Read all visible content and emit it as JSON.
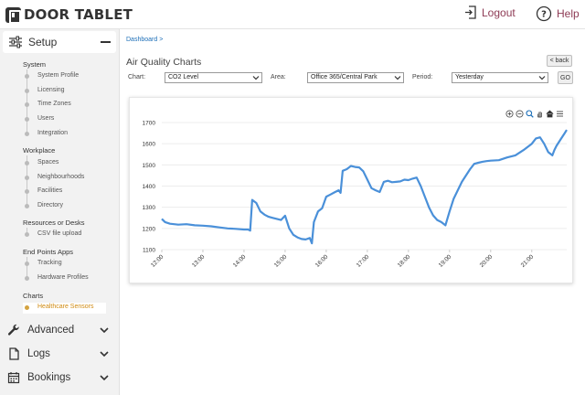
{
  "app": {
    "logo_text": "DOOR TABLET"
  },
  "header": {
    "logout_label": "Logout",
    "help_label": "Help"
  },
  "sidebar": {
    "setup_label": "Setup",
    "sections": [
      {
        "title": "System",
        "items": [
          "System Profile",
          "Licensing",
          "Time Zones",
          "Users",
          "Integration"
        ]
      },
      {
        "title": "Workplace",
        "items": [
          "Spaces",
          "Neighbourhoods",
          "Facilities",
          "Directory"
        ]
      },
      {
        "title": "Resources or Desks",
        "items": [
          "CSV file upload"
        ]
      },
      {
        "title": "End Points Apps",
        "items": [
          "Tracking",
          "Hardware Profiles"
        ]
      },
      {
        "title": "Charts",
        "items": [
          "Healthcare Sensors"
        ]
      }
    ],
    "active_item": "Healthcare Sensors",
    "groups": [
      {
        "label": "Advanced",
        "icon": "wrench-icon"
      },
      {
        "label": "Logs",
        "icon": "file-icon"
      },
      {
        "label": "Bookings",
        "icon": "calendar-icon"
      }
    ]
  },
  "main": {
    "breadcrumb": "Dashboard >",
    "title": "Air Quality Charts",
    "back_label": "< back",
    "chart_label": "Chart:",
    "chart_value": "CO2 Level",
    "area_label": "Area:",
    "area_value": "Office 365/Central Park",
    "period_label": "Period:",
    "period_value": "Yesterday",
    "go_label": "GO"
  },
  "colors": {
    "accent": "#8e3b55",
    "link": "#1d6fb8",
    "line": "#4a90d9",
    "active_item": "#d08a10"
  },
  "chart_data": {
    "type": "line",
    "title": "",
    "xlabel": "",
    "ylabel": "",
    "ylim": [
      1100,
      1700
    ],
    "yticks": [
      1100,
      1200,
      1300,
      1400,
      1500,
      1600,
      1700
    ],
    "xticks": [
      "12:00",
      "13:00",
      "14:00",
      "15:00",
      "16:00",
      "17:00",
      "18:00",
      "19:00",
      "20:00",
      "21:00"
    ],
    "xrange": [
      12.0,
      21.85
    ],
    "series": [
      {
        "name": "",
        "x": [
          12.0,
          12.08,
          12.2,
          12.4,
          12.6,
          12.8,
          13.0,
          13.2,
          13.4,
          13.6,
          13.8,
          14.0,
          14.1,
          14.15,
          14.2,
          14.3,
          14.4,
          14.5,
          14.6,
          14.7,
          14.8,
          14.9,
          15.0,
          15.1,
          15.2,
          15.3,
          15.4,
          15.5,
          15.6,
          15.65,
          15.7,
          15.8,
          15.9,
          16.0,
          16.1,
          16.2,
          16.3,
          16.35,
          16.4,
          16.5,
          16.6,
          16.7,
          16.8,
          16.9,
          17.0,
          17.1,
          17.2,
          17.3,
          17.4,
          17.5,
          17.6,
          17.7,
          17.8,
          17.9,
          18.0,
          18.1,
          18.2,
          18.3,
          18.4,
          18.5,
          18.6,
          18.7,
          18.8,
          18.9,
          19.0,
          19.1,
          19.2,
          19.3,
          19.4,
          19.5,
          19.6,
          19.7,
          19.8,
          19.9,
          20.0,
          20.2,
          20.4,
          20.6,
          20.8,
          21.0,
          21.1,
          21.2,
          21.3,
          21.4,
          21.5,
          21.55,
          21.6,
          21.7,
          21.8,
          21.85
        ],
        "values": [
          1245,
          1230,
          1222,
          1218,
          1220,
          1215,
          1213,
          1210,
          1205,
          1200,
          1198,
          1195,
          1195,
          1190,
          1335,
          1320,
          1280,
          1265,
          1255,
          1250,
          1245,
          1240,
          1260,
          1200,
          1170,
          1158,
          1150,
          1148,
          1155,
          1130,
          1230,
          1280,
          1295,
          1350,
          1360,
          1370,
          1380,
          1368,
          1472,
          1480,
          1495,
          1490,
          1488,
          1470,
          1430,
          1390,
          1380,
          1372,
          1420,
          1425,
          1418,
          1420,
          1422,
          1430,
          1428,
          1435,
          1440,
          1400,
          1350,
          1300,
          1262,
          1240,
          1230,
          1215,
          1280,
          1340,
          1380,
          1420,
          1450,
          1480,
          1505,
          1510,
          1515,
          1518,
          1520,
          1522,
          1535,
          1545,
          1570,
          1600,
          1625,
          1630,
          1600,
          1560,
          1545,
          1570,
          1590,
          1620,
          1650,
          1665
        ]
      }
    ],
    "grid": {
      "x": false,
      "y": true
    },
    "legend": "none",
    "toolbar_icons": [
      "zoom-in-icon",
      "zoom-out-icon",
      "magnify-icon",
      "pan-icon",
      "home-icon",
      "menu-icon"
    ]
  }
}
